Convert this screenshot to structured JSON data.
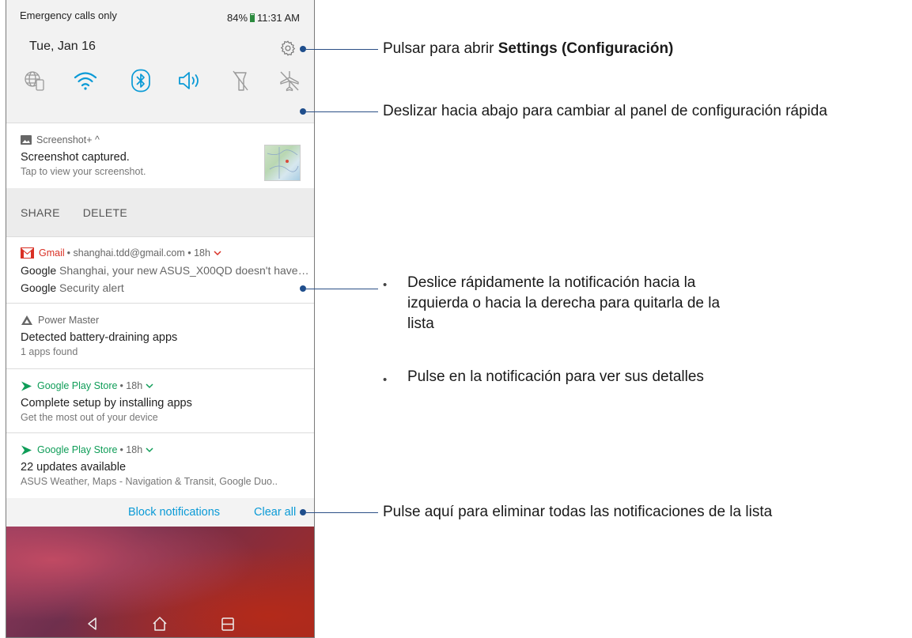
{
  "status_bar": {
    "carrier_text": "Emergency calls only",
    "battery_percent": "84%",
    "time": "11:31 AM"
  },
  "header": {
    "date": "Tue, Jan 16",
    "settings_icon": "gear-icon"
  },
  "quick_settings": [
    {
      "name": "data-icon",
      "state": "off"
    },
    {
      "name": "wifi-icon",
      "state": "on"
    },
    {
      "name": "bluetooth-icon",
      "state": "on"
    },
    {
      "name": "sound-icon",
      "state": "on"
    },
    {
      "name": "flashlight-icon",
      "state": "off"
    },
    {
      "name": "airplane-mode-icon",
      "state": "off"
    }
  ],
  "notifications": {
    "screenshot": {
      "app": "Screenshot+ ^",
      "title": "Screenshot captured.",
      "subtitle": "Tap to view your screenshot.",
      "action_share": "SHARE",
      "action_delete": "DELETE"
    },
    "gmail": {
      "app": "Gmail",
      "meta": "• shanghai.tdd@gmail.com • 18h",
      "line1_sender": "Google",
      "line1_text": "Shanghai, your new ASUS_X00QD doesn't have…",
      "line2_sender": "Google",
      "line2_text": "Security alert"
    },
    "power_master": {
      "app": "Power Master",
      "title": "Detected battery-draining apps",
      "subtitle": "1 apps found"
    },
    "play_store_1": {
      "app": "Google Play Store",
      "meta": "• 18h",
      "title": "Complete setup by installing apps",
      "subtitle": "Get the most out of your device"
    },
    "play_store_2": {
      "app": "Google Play Store",
      "meta": "• 18h",
      "title": "22 updates available",
      "subtitle": "ASUS Weather, Maps - Navigation & Transit, Google Duo.."
    }
  },
  "footer": {
    "block_label": "Block notifications",
    "clear_label": "Clear all"
  },
  "annotations": {
    "settings_prefix": "Pulsar para abrir ",
    "settings_bold": "Settings (Configuración)",
    "swipe_down": "Deslizar hacia abajo para cambiar al panel de configuración rápida",
    "swipe_bullet": "Deslice rápidamente la notificación hacia la izquierda o hacia la derecha para quitarla de la lista",
    "tap_bullet": "Pulse en la notificación para ver sus detalles",
    "clear_all": "Pulse aquí para eliminar todas las notificaciones de la lista"
  },
  "colors": {
    "accent": "#0a9ad6",
    "annotation_line": "#1f4e8c",
    "gmail_red": "#d93025",
    "play_green": "#0f9d58"
  }
}
